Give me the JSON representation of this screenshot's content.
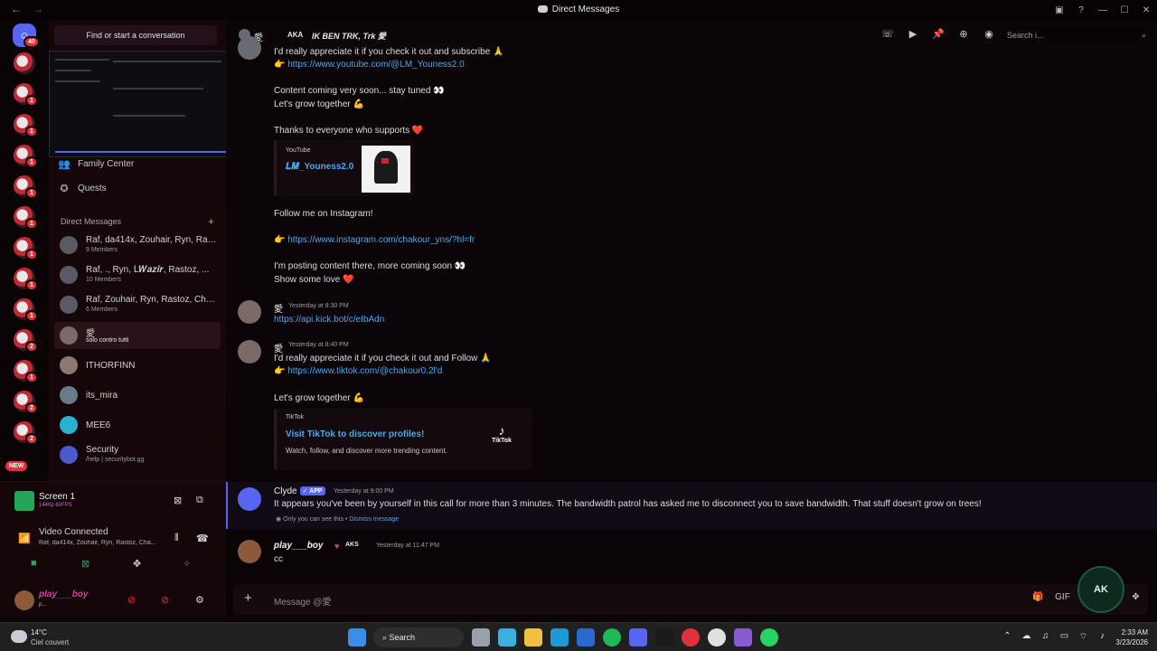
{
  "titlebar": {
    "title": "Direct Messages",
    "back": "←",
    "forward": "→"
  },
  "rail": {
    "home_badge": "40",
    "new_label": "NEW",
    "server_badges": [
      "1",
      "1",
      "1",
      "1",
      "1",
      "1",
      "1",
      "1",
      "2",
      "1",
      "2",
      "2"
    ]
  },
  "sidebar": {
    "search_label": "Find or start a conversation",
    "nav": [
      {
        "label": "Family Center"
      },
      {
        "label": "Quests"
      }
    ],
    "dm_header": "Direct Messages",
    "dms": [
      {
        "name": "Raf, da414x, Zouhair, Ryn, Ras...",
        "sub": "9 Members"
      },
      {
        "name": "Raf, ., Ryn, ꓡ𝑾𝒂𝒛𝒊𝒓, Rastoz, ...",
        "sub": "10 Members"
      },
      {
        "name": "Raf, Zouhair, Ryn, Rastoz, Cha...",
        "sub": "6 Members"
      },
      {
        "name": "愛",
        "sub": "solo contro tutti"
      },
      {
        "name": "ITHORFINN",
        "sub": ""
      },
      {
        "name": "its_mira",
        "sub": ""
      },
      {
        "name": "MEE6",
        "sub": ""
      },
      {
        "name": "Security",
        "sub": "/help | securitybot.gg"
      }
    ]
  },
  "voice": {
    "screen_title": "Screen 1",
    "screen_sub": "1440p 60FPS",
    "vc_title": "Video Connected",
    "vc_sub": "Raf, da414x, Zouhair, Ryn, Rastoz, Cha...",
    "user_name": "play___boy",
    "user_sub": "p..."
  },
  "chat_header": {
    "name": "愛",
    "tag": "AKA",
    "status": "IK BEN TRK, Trk 愛",
    "search_placeholder": "Search i..."
  },
  "messages": {
    "m1_line1": "I'd really appreciate it if you check it out and subscribe 🙏",
    "m1_link1": "https://www.youtube.com/@LM_Youness2.0",
    "m1_line2": "Content coming very soon... stay tuned 👀",
    "m1_line3": "Let's grow together 💪",
    "m1_line4": "Thanks to everyone who supports ❤️",
    "yt_provider": "YouTube",
    "yt_title": "𝑳𝑴_Youness2.0",
    "m1_line5": "Follow me on Instagram!",
    "m1_link2": "https://www.instagram.com/chakour_yns/?hl=fr",
    "m1_line6": "I'm posting content there, more coming soon 👀",
    "m1_line7": "Show some love ❤️",
    "m2_name": "愛",
    "m2_time": "Yesterday at 8:30 PM",
    "m2_link": "https://api.kick.bot/c/eIbAdn",
    "m3_name": "愛",
    "m3_time": "Yesterday at 8:40 PM",
    "m3_line1": "I'd really appreciate it if you check it out and Follow 🙏",
    "m3_link": "https://www.tiktok.com/@chakour0.2l'd",
    "m3_line2": "Let's grow together 💪",
    "tt_provider": "TikTok",
    "tt_title": "Visit TikTok to discover profiles!",
    "tt_desc": "Watch, follow, and discover more trending content.",
    "tt_logo": "TikTok",
    "clyde_name": "Clyde",
    "clyde_badge": "APP",
    "clyde_time": "Yesterday at 9:00 PM",
    "clyde_text": "It appears you've been by yourself in this call for more than 3 minutes. The bandwidth patrol has asked me to disconnect you to save bandwidth. That stuff doesn't grow on trees!",
    "clyde_only": "Only you can see this •",
    "clyde_dismiss": "Dismiss message",
    "m4_name": "play___boy",
    "m4_tag": "AKS",
    "m4_time": "Yesterday at 11:47 PM",
    "m4_text": "cc"
  },
  "composer": {
    "placeholder": "Message @愛"
  },
  "ak_badge": "AK",
  "taskbar": {
    "temp": "14°C",
    "condition": "Ciel couvert",
    "search": "Search",
    "time": "2:33 AM",
    "date": "3/23/2026"
  },
  "colors": {
    "accent": "#5865f2",
    "link": "#4aa7f0",
    "danger": "#e0313a",
    "online": "#23a55a"
  }
}
